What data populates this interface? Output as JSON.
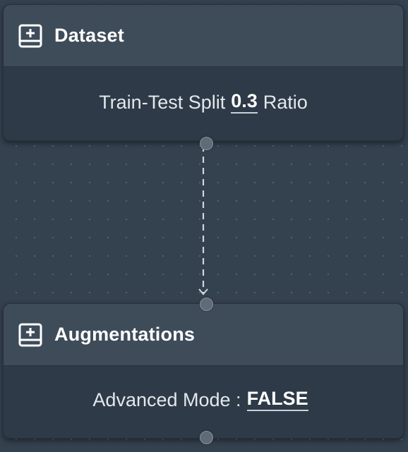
{
  "nodes": {
    "dataset": {
      "title": "Dataset",
      "param_label": "Train-Test Split",
      "param_value": "0.3",
      "param_suffix": "Ratio"
    },
    "augmentations": {
      "title": "Augmentations",
      "param_label": "Advanced Mode :",
      "param_value": "FALSE"
    }
  },
  "icons": {
    "node_icon": "add-box-icon"
  },
  "colors": {
    "canvas": "#34414f",
    "node_header": "#3e4b59",
    "node_body": "#2e3a47",
    "edge": "#d0d6dc"
  }
}
